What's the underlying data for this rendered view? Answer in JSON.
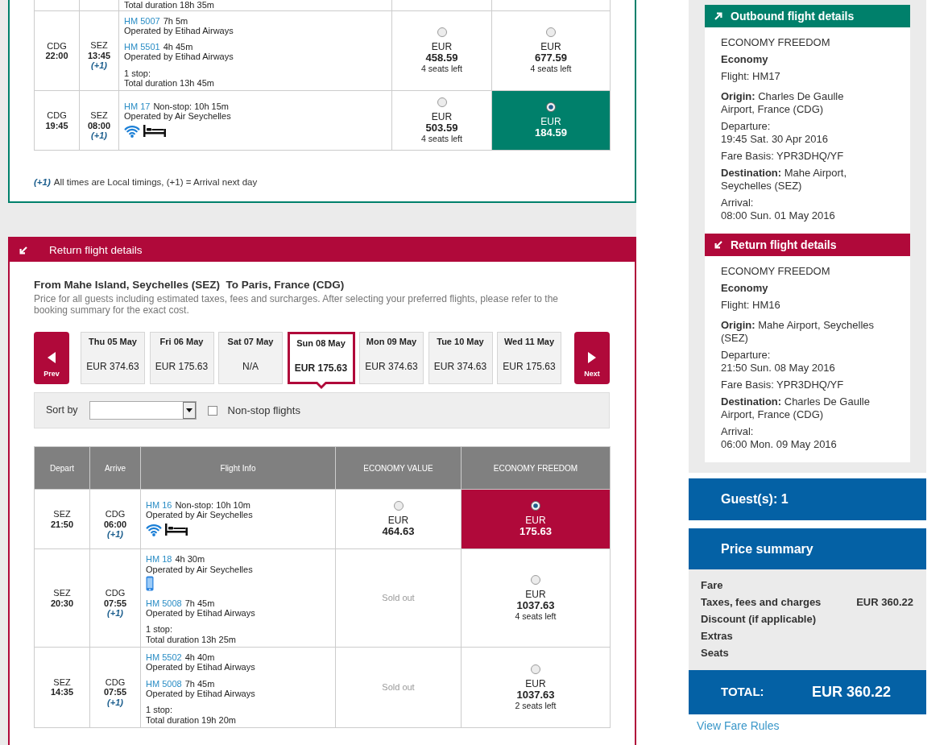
{
  "outbound": {
    "cut_row": {
      "flight_info": "Total duration 18h 35m"
    },
    "rows": [
      {
        "depart": {
          "airport": "CDG",
          "time": "22:00"
        },
        "arrive": {
          "airport": "SEZ",
          "time": "13:45",
          "next_day": "(+1)"
        },
        "segments": [
          {
            "flight": "HM 5007",
            "info": "7h 5m",
            "operator": "Operated by Etihad Airways"
          },
          {
            "flight": "HM 5501",
            "info": "4h 45m",
            "operator": "Operated by Etihad Airways"
          }
        ],
        "stops": [
          "1 stop:",
          "Total duration 13h 45m"
        ],
        "fares": [
          {
            "kind": "available",
            "currency": "EUR",
            "price": "458.59",
            "seats": "4 seats left",
            "selected": false
          },
          {
            "kind": "available",
            "currency": "EUR",
            "price": "677.59",
            "seats": "4 seats left",
            "selected": false
          }
        ]
      },
      {
        "depart": {
          "airport": "CDG",
          "time": "19:45"
        },
        "arrive": {
          "airport": "SEZ",
          "time": "08:00",
          "next_day": "(+1)"
        },
        "segments": [
          {
            "flight": "HM 17",
            "info": "Non-stop: 10h 15m",
            "operator": "Operated by Air Seychelles",
            "amenities": [
              {
                "kind": "wifi"
              },
              {
                "kind": "bed"
              }
            ]
          }
        ],
        "fares": [
          {
            "kind": "available",
            "currency": "EUR",
            "price": "503.59",
            "seats": "4 seats left",
            "selected": false
          },
          {
            "kind": "available",
            "currency": "EUR",
            "price": "184.59",
            "selected": true
          }
        ]
      }
    ],
    "footnote": {
      "marker": "(+1)",
      "text": "All times are Local timings, (+1) = Arrival next day"
    }
  },
  "return": {
    "title": "Return flight details",
    "route": "From Mahe Island, Seychelles (SEZ)  To Paris, France (CDG)",
    "note": "Price for all guests including estimated taxes, fees and surcharges. After selecting your preferred flights, please refer to the booking summary for the exact cost.",
    "date_nav": {
      "prev": "Prev",
      "next": "Next",
      "dates": [
        {
          "day": "Thu 05 May",
          "price": "EUR 374.63",
          "selected": false
        },
        {
          "day": "Fri 06 May",
          "price": "EUR 175.63",
          "selected": false
        },
        {
          "day": "Sat 07 May",
          "price": "N/A",
          "selected": false
        },
        {
          "day": "Sun 08 May",
          "price": "EUR 175.63",
          "selected": true
        },
        {
          "day": "Mon 09 May",
          "price": "EUR 374.63",
          "selected": false
        },
        {
          "day": "Tue 10 May",
          "price": "EUR 374.63",
          "selected": false
        },
        {
          "day": "Wed 11 May",
          "price": "EUR 175.63",
          "selected": false
        }
      ]
    },
    "filters": {
      "sort_label": "Sort by",
      "nonstop_label": "Non-stop flights",
      "nonstop_checked": false
    },
    "table": {
      "columns": [
        "Depart",
        "Arrive",
        "Flight Info",
        "ECONOMY VALUE",
        "ECONOMY FREEDOM"
      ],
      "rows": [
        {
          "depart": {
            "airport": "SEZ",
            "time": "21:50"
          },
          "arrive": {
            "airport": "CDG",
            "time": "06:00",
            "next_day": "(+1)"
          },
          "segments": [
            {
              "flight": "HM 16",
              "info": "Non-stop: 10h 10m",
              "operator": "Operated by Air Seychelles",
              "amenities": [
                {
                  "kind": "wifi"
                },
                {
                  "kind": "bed"
                }
              ]
            }
          ],
          "fares": [
            {
              "kind": "available",
              "currency": "EUR",
              "price": "464.63",
              "selected": false
            },
            {
              "kind": "available",
              "currency": "EUR",
              "price": "175.63",
              "selected": true
            }
          ]
        },
        {
          "depart": {
            "airport": "SEZ",
            "time": "20:30"
          },
          "arrive": {
            "airport": "CDG",
            "time": "07:55",
            "next_day": "(+1)"
          },
          "segments": [
            {
              "flight": "HM 18",
              "info": "4h 30m",
              "operator": "Operated by Air Seychelles",
              "amenities": [
                {
                  "kind": "phone"
                }
              ]
            },
            {
              "flight": "HM 5008",
              "info": "7h 45m",
              "operator": "Operated by Etihad Airways"
            }
          ],
          "stops": [
            "1 stop:",
            "Total duration 13h 25m"
          ],
          "fares": [
            {
              "kind": "sold_out",
              "text": "Sold out",
              "selected": false
            },
            {
              "kind": "available",
              "currency": "EUR",
              "price": "1037.63",
              "seats": "4 seats left",
              "selected": false
            }
          ]
        },
        {
          "depart": {
            "airport": "SEZ",
            "time": "14:35"
          },
          "arrive": {
            "airport": "CDG",
            "time": "07:55",
            "next_day": "(+1)"
          },
          "segments": [
            {
              "flight": "HM 5502",
              "info": "4h 40m",
              "operator": "Operated by Etihad Airways"
            },
            {
              "flight": "HM 5008",
              "info": "7h 45m",
              "operator": "Operated by Etihad Airways"
            }
          ],
          "stops": [
            "1 stop:",
            "Total duration 19h 20m"
          ],
          "fares": [
            {
              "kind": "sold_out",
              "text": "Sold out",
              "selected": false
            },
            {
              "kind": "available",
              "currency": "EUR",
              "price": "1037.63",
              "seats": "2 seats left",
              "selected": false
            }
          ]
        }
      ]
    }
  },
  "sidebar": {
    "flights": [
      {
        "kind": "outbound",
        "title": "Outbound flight details",
        "fare_family": "ECONOMY FREEDOM",
        "cabin": "Economy",
        "flight": "Flight: HM17",
        "origin": "**Origin:** Charles De Gaulle Airport, France (CDG)",
        "departure": [
          "Departure:",
          "19:45 Sat. 30 Apr 2016"
        ],
        "fare_basis": "Fare Basis: YPR3DHQ/YF",
        "destination": "**Destination:** Mahe Airport, Seychelles (SEZ)",
        "arrival": [
          "Arrival:",
          "08:00 Sun. 01 May 2016"
        ]
      },
      {
        "kind": "return",
        "title": "Return flight details",
        "fare_family": "ECONOMY FREEDOM",
        "cabin": "Economy",
        "flight": "Flight: HM16",
        "origin": "**Origin:** Mahe Airport, Seychelles (SEZ)",
        "departure": [
          "Departure:",
          "21:50 Sun. 08 May 2016"
        ],
        "fare_basis": "Fare Basis: YPR3DHQ/YF",
        "destination": "**Destination:** Charles De Gaulle Airport, France (CDG)",
        "arrival": [
          "Arrival:",
          "06:00 Mon. 09 May 2016"
        ]
      }
    ],
    "guests": "Guest(s): 1",
    "price_summary": {
      "title": "Price summary",
      "rows": [
        {
          "label": "Fare"
        },
        {
          "label": "Taxes, fees and charges",
          "value": "EUR 360.22"
        },
        {
          "label": "Discount (if applicable)"
        },
        {
          "label": "Extras"
        },
        {
          "label": "Seats"
        }
      ],
      "total_label": "TOTAL:",
      "total_value": "EUR 360.22"
    },
    "fare_rules_link": "View Fare Rules"
  }
}
